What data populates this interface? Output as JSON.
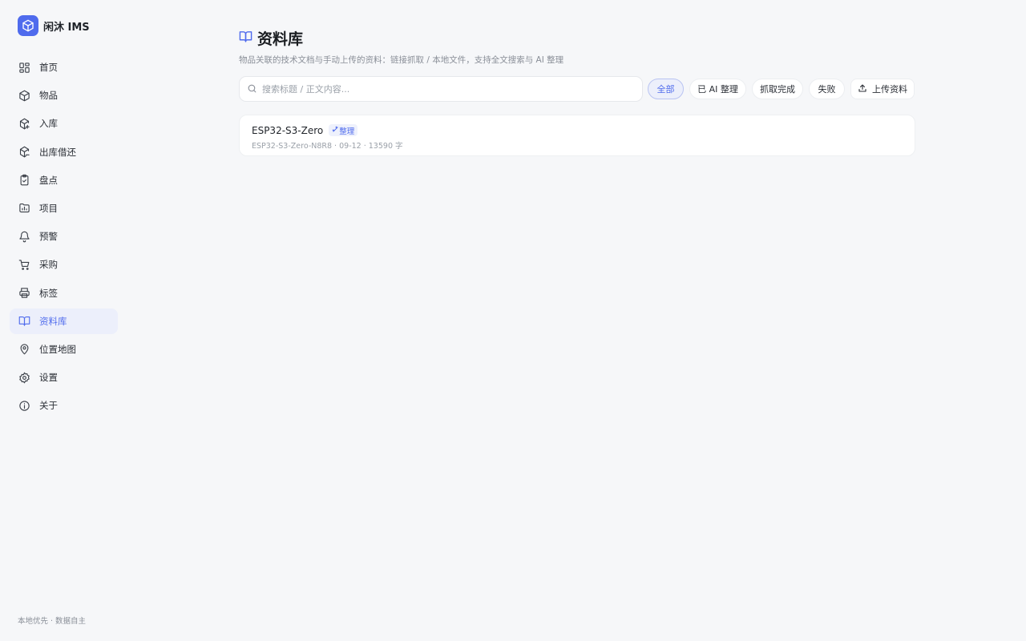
{
  "app": {
    "name": "闲沐 IMS",
    "footer": "本地优先 · 数据自主"
  },
  "sidebar": {
    "items": [
      {
        "id": "home",
        "label": "首页",
        "icon": "grid-icon"
      },
      {
        "id": "items",
        "label": "物品",
        "icon": "box-icon"
      },
      {
        "id": "inbound",
        "label": "入库",
        "icon": "box-in-icon"
      },
      {
        "id": "outbound",
        "label": "出库借还",
        "icon": "box-out-icon"
      },
      {
        "id": "stocktake",
        "label": "盘点",
        "icon": "clipboard-check-icon"
      },
      {
        "id": "projects",
        "label": "项目",
        "icon": "folder-chart-icon"
      },
      {
        "id": "alerts",
        "label": "预警",
        "icon": "bell-icon"
      },
      {
        "id": "purchase",
        "label": "采购",
        "icon": "cart-icon"
      },
      {
        "id": "labels",
        "label": "标签",
        "icon": "printer-icon"
      },
      {
        "id": "library",
        "label": "资料库",
        "icon": "book-open-icon",
        "active": true
      },
      {
        "id": "locations",
        "label": "位置地图",
        "icon": "map-pin-icon"
      },
      {
        "id": "settings",
        "label": "设置",
        "icon": "gear-icon"
      },
      {
        "id": "about",
        "label": "关于",
        "icon": "info-icon"
      }
    ]
  },
  "page": {
    "title": "资料库",
    "subtitle": "物品关联的技术文档与手动上传的资料：链接抓取 / 本地文件，支持全文搜索与 AI 整理"
  },
  "search": {
    "placeholder": "搜索标题 / 正文内容...",
    "value": ""
  },
  "filters": {
    "all": "全部",
    "ai": "已 AI 整理",
    "fetched": "抓取完成",
    "failed": "失败",
    "active": "all"
  },
  "upload_label": "上传资料",
  "documents": [
    {
      "title": "ESP32-S3-Zero",
      "badge": "整理",
      "meta": "ESP32-S3-Zero-N8R8 · 09-12 · 13590 字"
    }
  ],
  "colors": {
    "accent": "#4f6bed",
    "background": "#f6f7f9"
  }
}
